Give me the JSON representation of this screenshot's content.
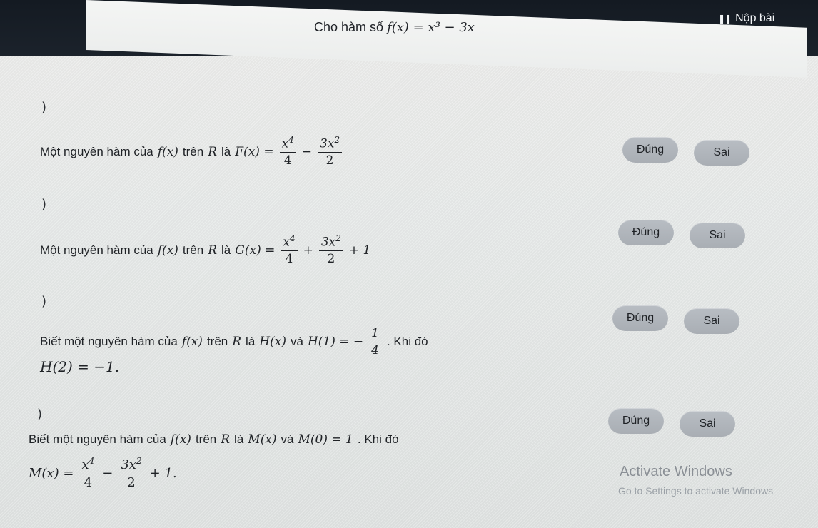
{
  "header": {
    "submit_label": "Nộp bài",
    "submit_icon": "pause-icon"
  },
  "problem": {
    "prefix": "Cho hàm số",
    "function": "f(x) = x³ − 3x"
  },
  "answer_labels": {
    "true": "Đúng",
    "false": "Sai"
  },
  "statements": [
    {
      "bracket": ")",
      "text_before": "Một nguyên hàm của",
      "fx": "f(x)",
      "text_on": "trên",
      "domain": "R",
      "text_is": "là",
      "lhs": "F(x) =",
      "frac1_num": "x",
      "frac1_num_exp": "4",
      "frac1_den": "4",
      "op": "−",
      "frac2_num": "3x",
      "frac2_num_exp": "2",
      "frac2_den": "2"
    },
    {
      "bracket": ")",
      "text_before": "Một nguyên hàm của",
      "fx": "f(x)",
      "text_on": "trên",
      "domain": "R",
      "text_is": "là",
      "lhs": "G(x) =",
      "frac1_num": "x",
      "frac1_num_exp": "4",
      "frac1_den": "4",
      "op": "+",
      "frac2_num": "3x",
      "frac2_num_exp": "2",
      "frac2_den": "2",
      "tail": "+ 1"
    },
    {
      "bracket": ")",
      "text_before": "Biết một nguyên hàm của",
      "fx": "f(x)",
      "text_on": "trên",
      "domain": "R",
      "text_is": "là",
      "hx": "H(x)",
      "text_and": "và",
      "cond_lhs": "H(1) = −",
      "cond_num": "1",
      "cond_den": "4",
      "text_then": ". Khi đó",
      "conclusion": "H(2) = −1."
    },
    {
      "bracket": ")",
      "text_before": "Biết một nguyên hàm của",
      "fx": "f(x)",
      "text_on": "trên",
      "domain": "R",
      "text_is": "là",
      "mx": "M(x)",
      "text_and": "và",
      "cond": "M(0) = 1",
      "text_then": ". Khi đó",
      "concl_lhs": "M(x) =",
      "frac1_num": "x",
      "frac1_num_exp": "4",
      "frac1_den": "4",
      "op": "−",
      "frac2_num": "3x",
      "frac2_num_exp": "2",
      "frac2_den": "2",
      "tail": "+ 1."
    }
  ],
  "watermark": {
    "title": "Activate Windows",
    "subtitle": "Go to Settings to activate Windows"
  }
}
